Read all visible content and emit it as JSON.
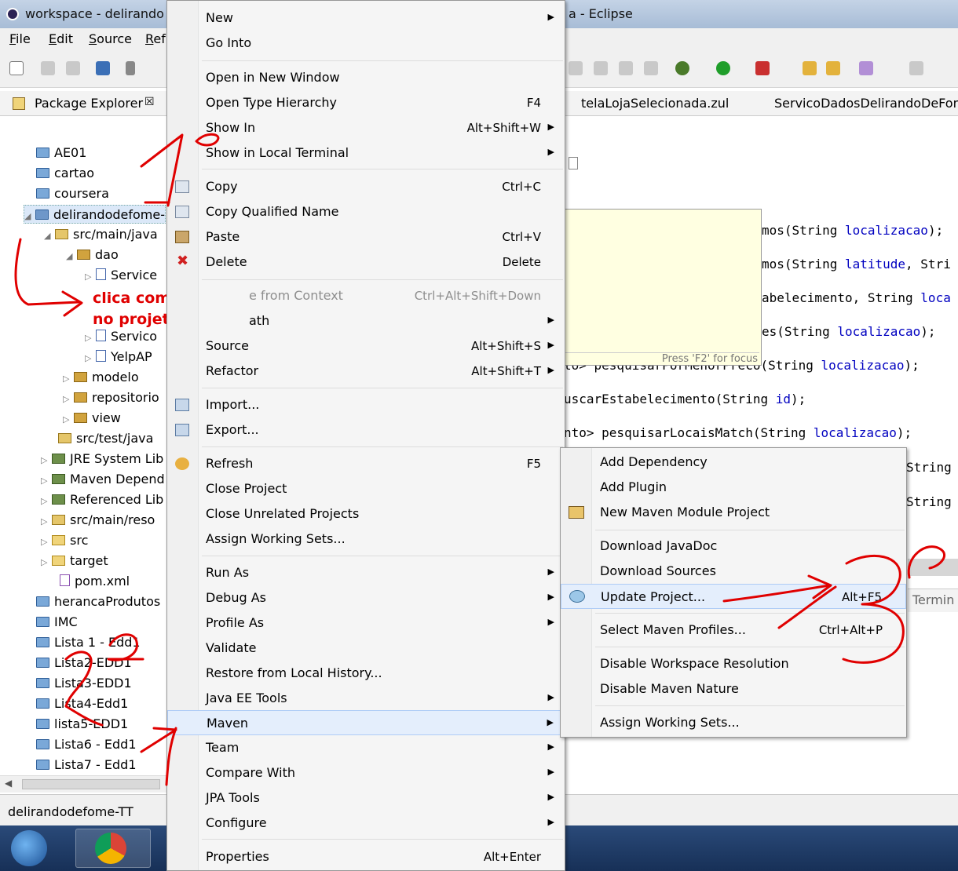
{
  "window": {
    "title_left": "workspace - delirando",
    "title_right": "a - Eclipse"
  },
  "menubar": {
    "file": "File",
    "edit": "Edit",
    "source": "Source",
    "refactor": "Ref"
  },
  "package_explorer": {
    "tab_label": "Package Explorer",
    "tree": [
      "AE01",
      "cartao",
      "coursera",
      "delirandodefome-",
      "src/main/java",
      "dao",
      "Service",
      "",
      "",
      "Servico",
      "YelpAP",
      "modelo",
      "repositorio",
      "view",
      "src/test/java",
      "JRE System Lib",
      "Maven Depend",
      "Referenced Lib",
      "src/main/reso",
      "src",
      "target",
      "pom.xml",
      "herancaProdutos",
      "IMC",
      "Lista 1 - Edd1",
      "Lista2-EDD1",
      "Lista3-EDD1",
      "Lista4-Edd1",
      "lista5-EDD1",
      "Lista6 - Edd1",
      "Lista7 - Edd1"
    ]
  },
  "editor": {
    "tabs": [
      "telaLojaSelecionada.zul",
      "ServicoDadosDelirandoDeFom"
    ],
    "tooltip_hint": "Press 'F2' for focus",
    "code_lines": [
      {
        "pre": "mos(String ",
        "param": "localizacao",
        "post": ");"
      },
      {
        "pre": "mos(String ",
        "param": "latitude",
        "post": ", Stri"
      },
      {
        "pre": "abelecimento, String ",
        "param": "loca",
        "post": ""
      },
      {
        "pre": "es(String ",
        "param": "localizacao",
        "post": ");"
      },
      {
        "pre": "to> pesquisarPorMenorPreco(String ",
        "param": "localizacao",
        "post": ");"
      },
      {
        "pre": "uscarEstabelecimento(String ",
        "param": "id",
        "post": ");"
      },
      {
        "pre": "nto> pesquisarLocaisMatch(String ",
        "param": "localizacao",
        "post": ");"
      },
      {
        "pre": "String",
        "param": "",
        "post": ""
      },
      {
        "pre": "String",
        "param": "",
        "post": ""
      }
    ],
    "terminal_label": "Termin"
  },
  "context_menu": {
    "items": [
      {
        "label": "New",
        "sub": true
      },
      {
        "label": "Go Into"
      },
      {
        "label": "Open in New Window"
      },
      {
        "label": "Open Type Hierarchy",
        "key": "F4"
      },
      {
        "label": "Show In",
        "key": "Alt+Shift+W",
        "sub": true
      },
      {
        "label": "Show in Local Terminal",
        "sub": true
      },
      {
        "label": "Copy",
        "key": "Ctrl+C"
      },
      {
        "label": "Copy Qualified Name"
      },
      {
        "label": "Paste",
        "key": "Ctrl+V"
      },
      {
        "label": "Delete",
        "key": "Delete"
      },
      {
        "label": "e from Context",
        "key": "Ctrl+Alt+Shift+Down"
      },
      {
        "label": "ath",
        "sub": true
      },
      {
        "label": "Source",
        "key": "Alt+Shift+S",
        "sub": true
      },
      {
        "label": "Refactor",
        "key": "Alt+Shift+T",
        "sub": true
      },
      {
        "label": "Import..."
      },
      {
        "label": "Export..."
      },
      {
        "label": "Refresh",
        "key": "F5"
      },
      {
        "label": "Close Project"
      },
      {
        "label": "Close Unrelated Projects"
      },
      {
        "label": "Assign Working Sets..."
      },
      {
        "label": "Run As",
        "sub": true
      },
      {
        "label": "Debug As",
        "sub": true
      },
      {
        "label": "Profile As",
        "sub": true
      },
      {
        "label": "Validate"
      },
      {
        "label": "Restore from Local History..."
      },
      {
        "label": "Java EE Tools",
        "sub": true
      },
      {
        "label": "Maven",
        "sub": true
      },
      {
        "label": "Team",
        "sub": true
      },
      {
        "label": "Compare With",
        "sub": true
      },
      {
        "label": "JPA Tools",
        "sub": true
      },
      {
        "label": "Configure",
        "sub": true
      },
      {
        "label": "Properties",
        "key": "Alt+Enter"
      }
    ]
  },
  "maven_submenu": {
    "items": [
      {
        "label": "Add Dependency"
      },
      {
        "label": "Add Plugin"
      },
      {
        "label": "New Maven Module Project"
      },
      {
        "label": "Download JavaDoc"
      },
      {
        "label": "Download Sources"
      },
      {
        "label": "Update Project...",
        "key": "Alt+F5"
      },
      {
        "label": "Select Maven Profiles...",
        "key": "Ctrl+Alt+P"
      },
      {
        "label": "Disable Workspace Resolution"
      },
      {
        "label": "Disable Maven Nature"
      },
      {
        "label": "Assign Working Sets..."
      }
    ]
  },
  "annotation": {
    "line1": "clica com o direito",
    "line2": "no projeto"
  },
  "status_bar": {
    "selection": "delirandodefome-TT"
  },
  "colors": {
    "annotation_red": "#e00000",
    "menu_highlight": "#e4eefc",
    "tooltip_bg": "#ffffe1"
  }
}
